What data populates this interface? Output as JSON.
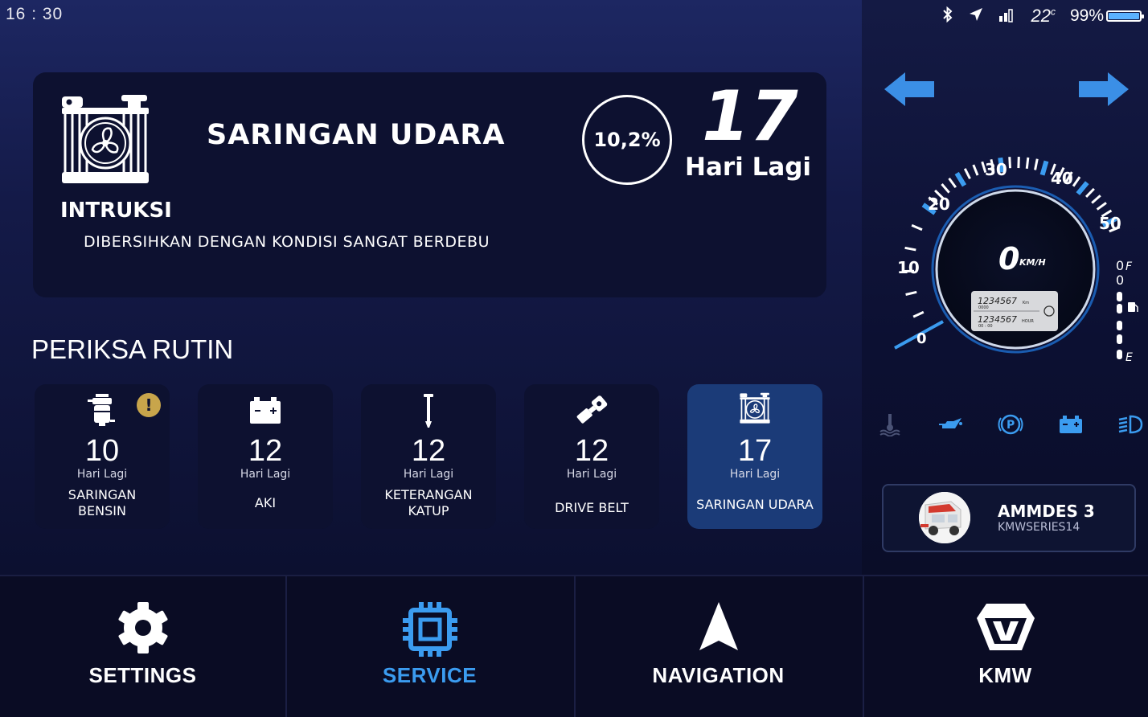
{
  "status": {
    "time": "16 : 30",
    "temperature": "22",
    "temperature_unit": "c",
    "battery": "99%",
    "battery_level": 0.99
  },
  "instruction_card": {
    "title": "SARINGAN UDARA",
    "instruction_heading": "INTRUKSI",
    "instruction_text": "DIBERSIHKAN DENGAN KONDISI SANGAT BERDEBU",
    "percent": "10,2%",
    "days_remaining": "17",
    "days_label": "Hari Lagi",
    "icon": "radiator-fan-icon"
  },
  "routine": {
    "title": "PERIKSA RUTIN",
    "items": [
      {
        "icon": "fuel-filter-icon",
        "days": "10",
        "unit": "Hari Lagi",
        "label": "SARINGAN BENSIN",
        "warning": "!"
      },
      {
        "icon": "car-battery-icon",
        "days": "12",
        "unit": "Hari Lagi",
        "label": "AKI"
      },
      {
        "icon": "valve-icon",
        "days": "12",
        "unit": "Hari Lagi",
        "label": "KETERANGAN KATUP"
      },
      {
        "icon": "drive-belt-icon",
        "days": "12",
        "unit": "Hari Lagi",
        "label": "DRIVE BELT"
      },
      {
        "icon": "radiator-fan-icon",
        "days": "17",
        "unit": "Hari Lagi",
        "label": "SARINGAN UDARA",
        "active": true
      }
    ]
  },
  "gauge": {
    "speed": "0",
    "speed_unit": "KM/H",
    "tick_labels": [
      "0",
      "10",
      "20",
      "30",
      "40",
      "50"
    ],
    "odometer": "1234567",
    "odometer_unit": "Km",
    "odometer_sub": "0000",
    "hour_meter": "1234567",
    "hour_unit": "HOUR",
    "hour_sub": "00 : 00",
    "fuel_full": "F",
    "fuel_empty": "E",
    "fuel_zero_top": "0",
    "fuel_zero_second": "0"
  },
  "indicators": [
    "coolant-temp-icon",
    "oil-pressure-icon",
    "parking-brake-icon",
    "battery-warning-icon",
    "headlight-icon"
  ],
  "vehicle": {
    "name": "AMMDES 3",
    "series": "KMWSERIES14"
  },
  "nav": {
    "settings": "SETTINGS",
    "service": "SERVICE",
    "navigation": "NAVIGATION",
    "kmw": "KMW"
  },
  "colors": {
    "accent": "#3b9cf0",
    "active_tile": "#1b3b78",
    "warning": "#c8a54b"
  }
}
